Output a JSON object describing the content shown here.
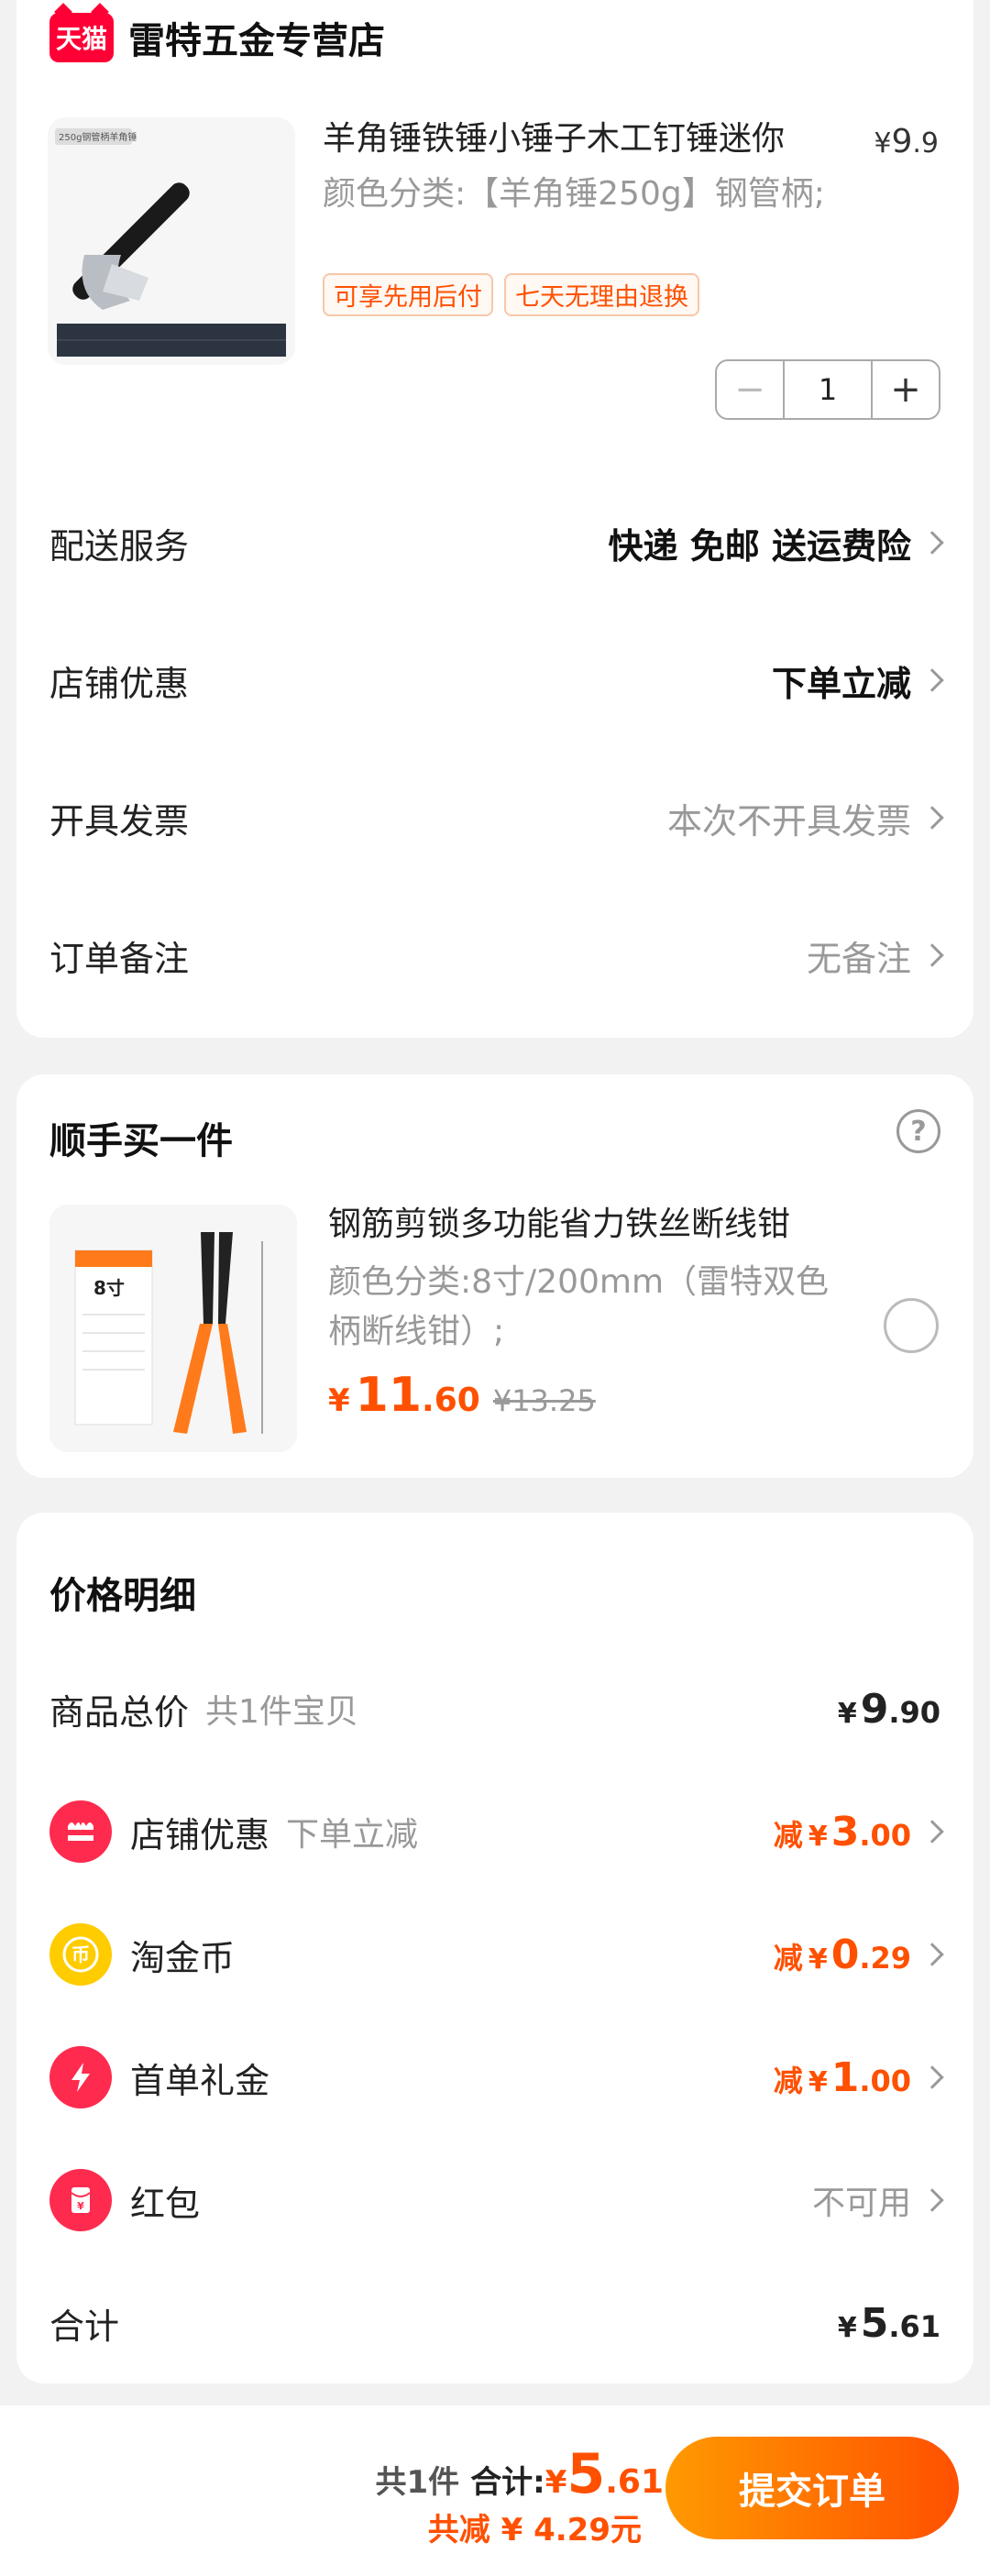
{
  "shop": {
    "logo_text": "天猫",
    "name": "雷特五金专营店"
  },
  "product": {
    "thumb_caption": "250g钢管柄羊角锤",
    "title": "羊角锤铁锤小锤子木工钉锤迷你",
    "price_symbol": "¥",
    "price_int": "9",
    "price_dec": ".9",
    "spec": "颜色分类:【羊角锤250g】钢管柄;",
    "tags": [
      "可享先用后付",
      "七天无理由退换"
    ],
    "quantity": "1"
  },
  "services": [
    {
      "label": "配送服务",
      "value": "快递 免邮 送运费险",
      "style": "bold"
    },
    {
      "label": "店铺优惠",
      "value": "下单立减",
      "style": "bold"
    },
    {
      "label": "开具发票",
      "value": "本次不开具发票",
      "style": "grey"
    },
    {
      "label": "订单备注",
      "value": "无备注",
      "style": "grey"
    }
  ],
  "addon": {
    "title": "顺手买一件",
    "name": "钢筋剪锁多功能省力铁丝断线钳",
    "spec": "颜色分类:8寸/200mm（雷特双色柄断线钳）;",
    "thumb_label": "8寸",
    "price_symbol": "¥",
    "price_int": "11",
    "price_dec": ".60",
    "old_price": "¥13.25"
  },
  "price_detail": {
    "title": "价格明细",
    "goods_total": {
      "label": "商品总价",
      "sub": "共1件宝贝",
      "yen": "¥",
      "int": "9",
      "dec": ".90"
    },
    "shop_discount": {
      "label": "店铺优惠",
      "sub": "下单立减",
      "prefix": "减",
      "yen": "¥",
      "int": "3",
      "dec": ".00",
      "icon": "shop-discount-icon"
    },
    "coins": {
      "label": "淘金币",
      "prefix": "减",
      "yen": "¥",
      "int": "0",
      "dec": ".29",
      "icon": "coin-icon"
    },
    "first_order": {
      "label": "首单礼金",
      "prefix": "减",
      "yen": "¥",
      "int": "1",
      "dec": ".00",
      "icon": "lightning-icon"
    },
    "red_packet": {
      "label": "红包",
      "value": "不可用",
      "icon": "red-packet-icon"
    },
    "total": {
      "label": "合计",
      "yen": "¥",
      "int": "5",
      "dec": ".61"
    }
  },
  "bottom": {
    "count": "共1件",
    "total_label": "合计:",
    "yen": "¥",
    "int": "5",
    "dec": ".61",
    "saved": "共减 ¥ 4.29元",
    "submit": "提交订单"
  },
  "colors": {
    "accent": "#ff5000",
    "tmall_red": "#ff0036",
    "coin_yellow": "#ffcc00"
  }
}
